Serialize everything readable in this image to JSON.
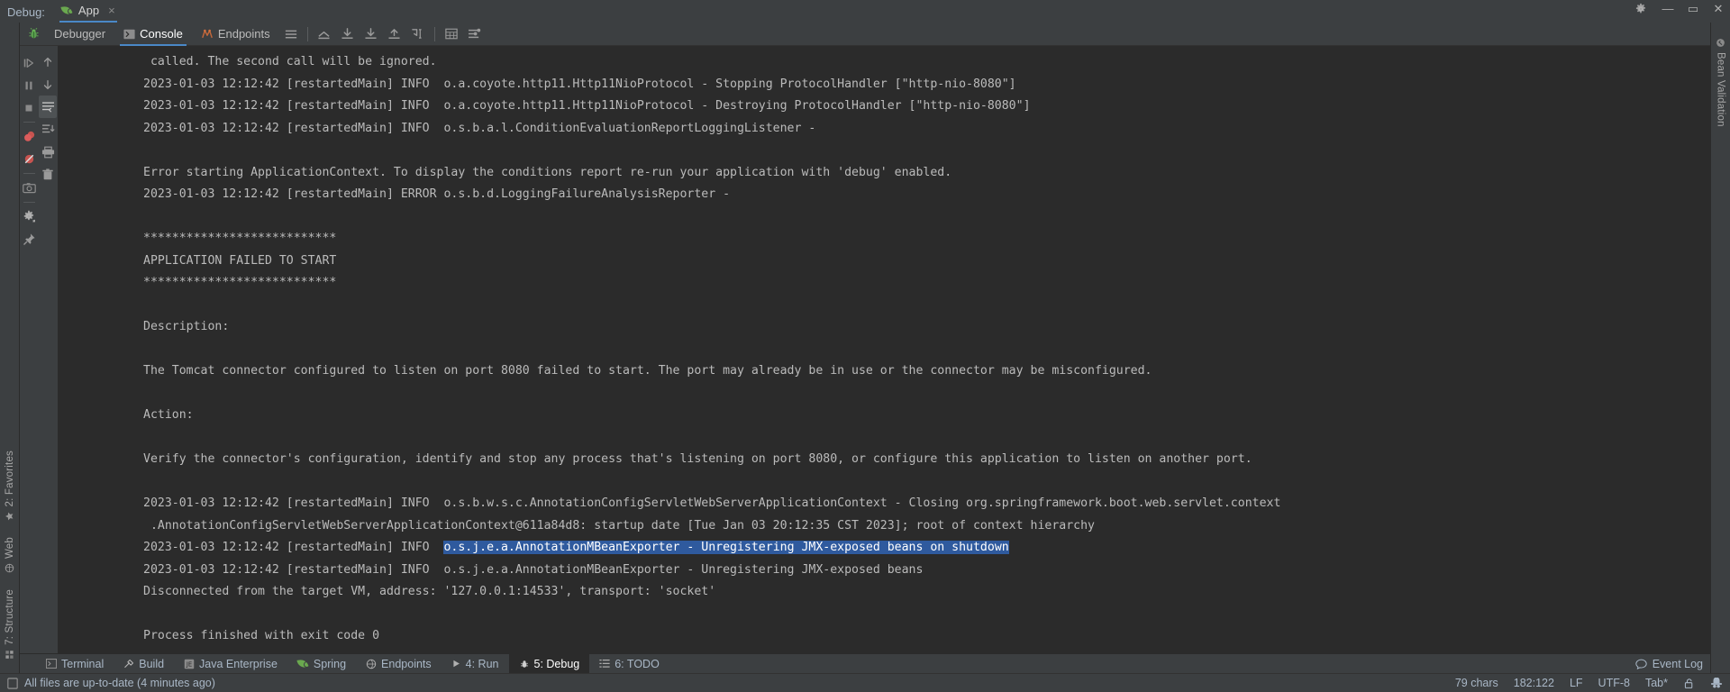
{
  "window": {
    "debug_label": "Debug:",
    "app_tab_label": "App",
    "app_tab_icon": "spring-leaf-icon",
    "tab_close": "×",
    "settings_icon": "gear-icon",
    "minimize": "—",
    "maximize": "▭",
    "close": "✕"
  },
  "debug_toolbar": {
    "run_icon": "bug-icon",
    "tabs": [
      {
        "label": "Debugger",
        "icon": "debugger-icon",
        "active": false
      },
      {
        "label": "Console",
        "icon": "console-icon",
        "active": true
      },
      {
        "label": "Endpoints",
        "icon": "endpoints-icon",
        "active": false
      }
    ],
    "icons": [
      "layout-settings-icon",
      "mute-breakpoints-icon",
      "step-over-icon",
      "step-into-icon",
      "step-out-icon",
      "run-to-cursor-icon",
      "evaluate-expression-icon",
      "settings-list-icon"
    ]
  },
  "debug_actions": {
    "primary": [
      "resume-program-icon",
      "pause-program-icon",
      "stop-program-icon",
      "view-breakpoints-icon",
      "mute-breakpoints-icon",
      "camera-icon",
      "settings-gear-icon",
      "pin-tab-icon"
    ],
    "console": [
      "scroll-up-icon",
      "scroll-down-icon",
      "soft-wrap-icon",
      "scroll-to-end-icon",
      "print-icon",
      "clear-all-icon"
    ]
  },
  "left_stripe": {
    "items": [
      {
        "label": "2: Favorites",
        "icon": "star-icon"
      },
      {
        "label": "Web",
        "icon": "globe-icon"
      },
      {
        "label": "7: Structure",
        "icon": "structure-icon"
      }
    ]
  },
  "right_stripe": {
    "items": [
      {
        "label": "Bean Validation",
        "icon": "bean-validation-icon"
      }
    ]
  },
  "console_output": {
    "selection_color": "#2f5a9e",
    "lines": [
      {
        "text": " called. The second call will be ignored."
      },
      {
        "text": "2023-01-03 12:12:42 [restartedMain] INFO  o.a.coyote.http11.Http11NioProtocol - Stopping ProtocolHandler [\"http-nio-8080\"]"
      },
      {
        "text": "2023-01-03 12:12:42 [restartedMain] INFO  o.a.coyote.http11.Http11NioProtocol - Destroying ProtocolHandler [\"http-nio-8080\"]"
      },
      {
        "text": "2023-01-03 12:12:42 [restartedMain] INFO  o.s.b.a.l.ConditionEvaluationReportLoggingListener - "
      },
      {
        "text": ""
      },
      {
        "text": "Error starting ApplicationContext. To display the conditions report re-run your application with 'debug' enabled."
      },
      {
        "text": "2023-01-03 12:12:42 [restartedMain] ERROR o.s.b.d.LoggingFailureAnalysisReporter - "
      },
      {
        "text": ""
      },
      {
        "text": "***************************"
      },
      {
        "text": "APPLICATION FAILED TO START"
      },
      {
        "text": "***************************"
      },
      {
        "text": ""
      },
      {
        "text": "Description:"
      },
      {
        "text": ""
      },
      {
        "text": "The Tomcat connector configured to listen on port 8080 failed to start. The port may already be in use or the connector may be misconfigured."
      },
      {
        "text": ""
      },
      {
        "text": "Action:"
      },
      {
        "text": ""
      },
      {
        "text": "Verify the connector's configuration, identify and stop any process that's listening on port 8080, or configure this application to listen on another port."
      },
      {
        "text": ""
      },
      {
        "text": "2023-01-03 12:12:42 [restartedMain] INFO  o.s.b.w.s.c.AnnotationConfigServletWebServerApplicationContext - Closing org.springframework.boot.web.servlet.context"
      },
      {
        "text": " .AnnotationConfigServletWebServerApplicationContext@611a84d8: startup date [Tue Jan 03 20:12:35 CST 2023]; root of context hierarchy"
      },
      {
        "prefix": "2023-01-03 12:12:42 [restartedMain] INFO  ",
        "selected": "o.s.j.e.a.AnnotationMBeanExporter - Unregistering JMX-exposed beans on shutdown",
        "text": ""
      },
      {
        "text": "2023-01-03 12:12:42 [restartedMain] INFO  o.s.j.e.a.AnnotationMBeanExporter - Unregistering JMX-exposed beans"
      },
      {
        "text": "Disconnected from the target VM, address: '127.0.0.1:14533', transport: 'socket'"
      },
      {
        "text": ""
      },
      {
        "text": "Process finished with exit code 0"
      }
    ]
  },
  "tool_window_bar": {
    "items": [
      {
        "label": "Terminal",
        "icon": "terminal-icon",
        "active": false
      },
      {
        "label": "Build",
        "icon": "build-hammer-icon",
        "active": false
      },
      {
        "label": "Java Enterprise",
        "icon": "java-enterprise-icon",
        "active": false
      },
      {
        "label": "Spring",
        "icon": "spring-leaf-icon",
        "active": false
      },
      {
        "label": "Endpoints",
        "icon": "endpoints-globe-icon",
        "active": false
      },
      {
        "label": "4: Run",
        "icon": "run-play-icon",
        "active": false
      },
      {
        "label": "5: Debug",
        "icon": "bug-icon",
        "active": true
      },
      {
        "label": "6: TODO",
        "icon": "todo-list-icon",
        "active": false
      }
    ],
    "event_log": {
      "label": "Event Log",
      "icon": "event-log-icon"
    }
  },
  "status_bar": {
    "message": "All files are up-to-date (4 minutes ago)",
    "message_icon": "file-icon",
    "chars": "79 chars",
    "caret": "182:122",
    "line_separator": "LF",
    "encoding": "UTF-8",
    "indent": "Tab*",
    "lock_icon": "unlocked-icon",
    "inspector_icon": "inspector-hat-icon"
  }
}
